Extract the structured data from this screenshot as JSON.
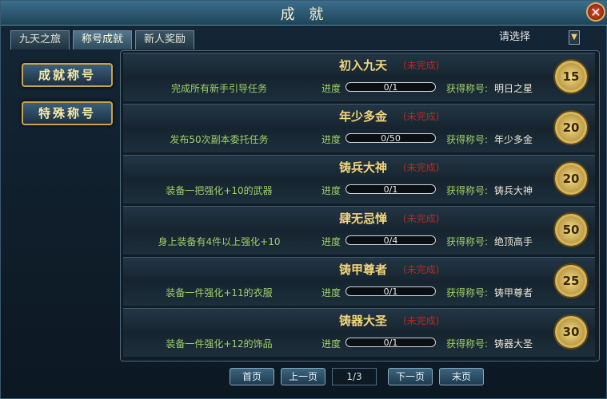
{
  "window": {
    "title": "成 就",
    "close_symbol": "✕"
  },
  "tabs": [
    {
      "label": "九天之旅"
    },
    {
      "label": "称号成就"
    },
    {
      "label": "新人奖励"
    }
  ],
  "select": {
    "value": "请选择",
    "arrow": "▼"
  },
  "categories": [
    {
      "label": "成就称号"
    },
    {
      "label": "特殊称号"
    }
  ],
  "labels": {
    "progress": "进度",
    "reward": "获得称号:"
  },
  "achievements": [
    {
      "title": "初入九天",
      "status": "(未完成)",
      "desc": "完成所有新手引导任务",
      "progress_text": "0/1",
      "progress_fraction": 0,
      "reward": "明日之星",
      "points": "15"
    },
    {
      "title": "年少多金",
      "status": "(未完成)",
      "desc": "发布50次副本委托任务",
      "progress_text": "0/50",
      "progress_fraction": 0,
      "reward": "年少多金",
      "points": "20"
    },
    {
      "title": "铸兵大神",
      "status": "(未完成)",
      "desc": "装备一把强化+10的武器",
      "progress_text": "0/1",
      "progress_fraction": 0,
      "reward": "铸兵大神",
      "points": "20"
    },
    {
      "title": "肆无忌惮",
      "status": "(未完成)",
      "desc": "身上装备有4件以上强化+10",
      "progress_text": "0/4",
      "progress_fraction": 0,
      "reward": "绝顶高手",
      "points": "50"
    },
    {
      "title": "铸甲尊者",
      "status": "(未完成)",
      "desc": "装备一件强化+11的衣服",
      "progress_text": "0/1",
      "progress_fraction": 0,
      "reward": "铸甲尊者",
      "points": "25"
    },
    {
      "title": "铸器大圣",
      "status": "(未完成)",
      "desc": "装备一件强化+12的饰品",
      "progress_text": "0/1",
      "progress_fraction": 0,
      "reward": "铸器大圣",
      "points": "30"
    }
  ],
  "pager": {
    "first": "首页",
    "prev": "上一页",
    "indicator": "1/3",
    "next": "下一页",
    "last": "末页"
  }
}
